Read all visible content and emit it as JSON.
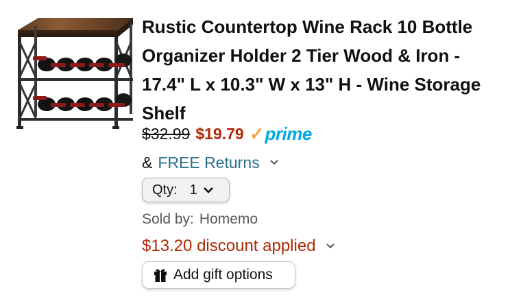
{
  "product": {
    "title": "Rustic Countertop Wine Rack 10 Bottle Organizer Holder 2 Tier Wood & Iron - 17.4\" L x 10.3\" W x 13\" H - Wine Storage Shelf",
    "image_icon": "wine-rack-product-image"
  },
  "pricing": {
    "list_price": "$32.99",
    "sale_price": "$19.79",
    "prime_label": "prime"
  },
  "returns": {
    "prefix": "&",
    "label": "FREE Returns"
  },
  "quantity": {
    "label": "Qty:",
    "value": "1"
  },
  "seller": {
    "label": "Sold by:",
    "name": "Homemo"
  },
  "discount": {
    "label": "$13.20 discount applied"
  },
  "gift": {
    "label": "Add gift options",
    "icon": "gift-icon"
  },
  "colors": {
    "price_red": "#b12704",
    "link_teal": "#2a6f8a",
    "prime_blue": "#00a8e1",
    "prime_orange": "#f3a847"
  }
}
